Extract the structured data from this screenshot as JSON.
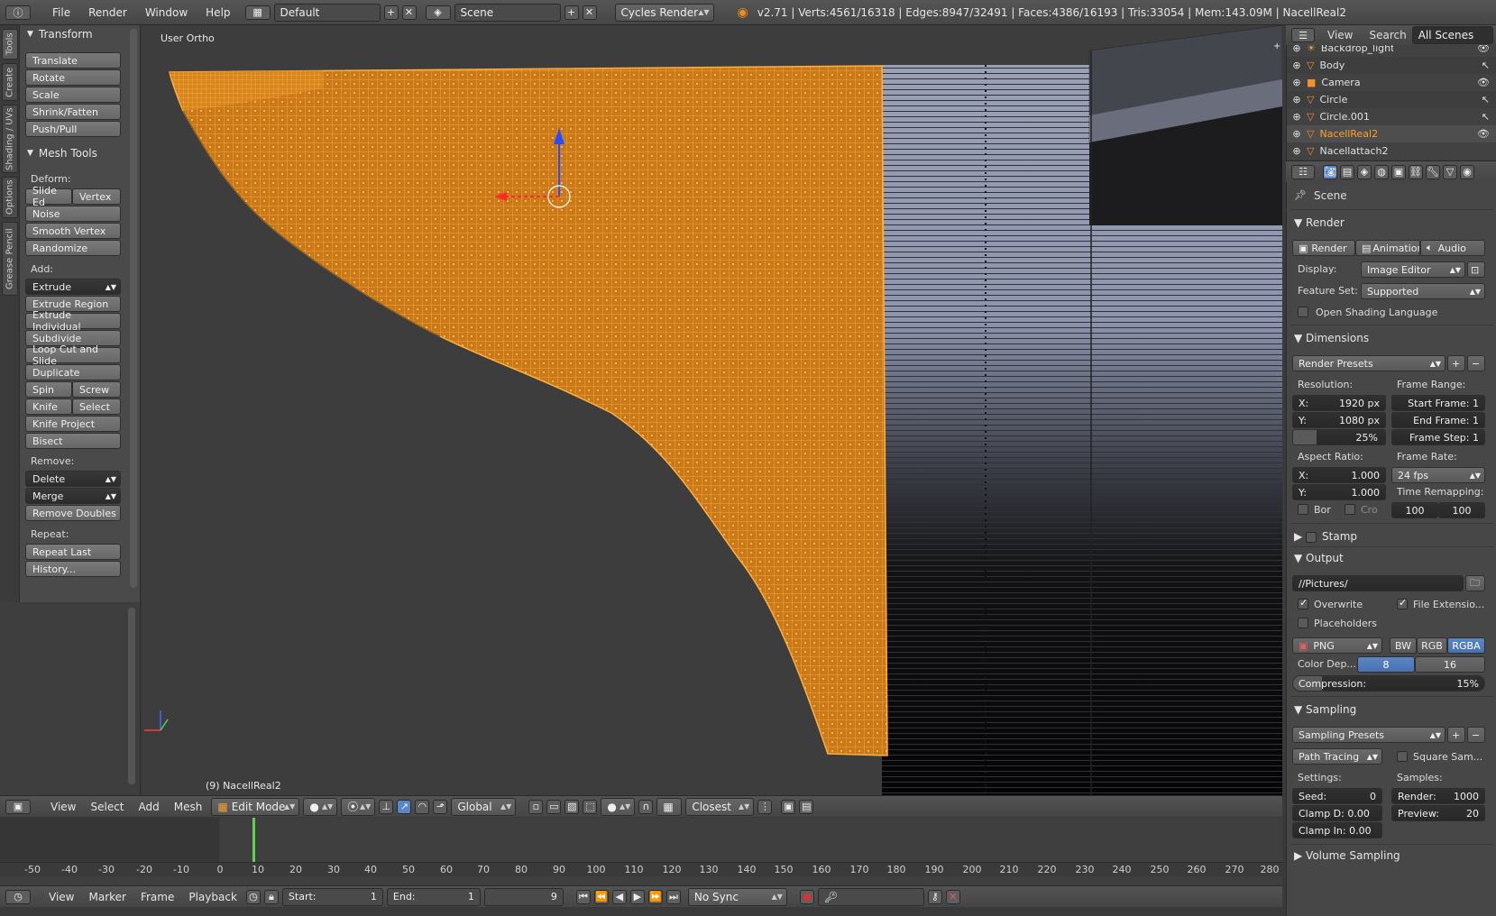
{
  "topbar": {
    "menus": [
      "File",
      "Render",
      "Window",
      "Help"
    ],
    "layout": "Default",
    "scene": "Scene",
    "engine": "Cycles Render",
    "stats": "v2.71 | Verts:4561/16318 | Edges:8947/32491 | Faces:4386/16193 | Tris:33054 | Mem:143.09M | NacellReal2"
  },
  "tool_tabs": [
    "Tools",
    "Create",
    "Shading / UVs",
    "Options",
    "Grease Pencil"
  ],
  "transform": {
    "title": "Transform",
    "buttons": [
      "Translate",
      "Rotate",
      "Scale",
      "Shrink/Fatten",
      "Push/Pull"
    ]
  },
  "mesh_tools": {
    "title": "Mesh Tools",
    "deform_label": "Deform:",
    "slide_edge": "Slide Ed",
    "vertex": "Vertex",
    "noise": "Noise",
    "smooth_vertex": "Smooth Vertex",
    "randomize": "Randomize",
    "add_label": "Add:",
    "extrude": "Extrude",
    "extrude_region": "Extrude Region",
    "extrude_individual": "Extrude Individual",
    "subdivide": "Subdivide",
    "loop_cut": "Loop Cut and Slide",
    "duplicate": "Duplicate",
    "spin": "Spin",
    "screw": "Screw",
    "knife": "Knife",
    "select": "Select",
    "knife_project": "Knife Project",
    "bisect": "Bisect",
    "remove_label": "Remove:",
    "delete": "Delete",
    "merge": "Merge",
    "remove_doubles": "Remove Doubles",
    "repeat_label": "Repeat:",
    "repeat_last": "Repeat Last",
    "history": "History..."
  },
  "viewport": {
    "view_name": "User Ortho",
    "object_label": "(9) NacellReal2",
    "selection_color": "#f39a1e"
  },
  "view3d_header": {
    "menus": [
      "View",
      "Select",
      "Add",
      "Mesh"
    ],
    "mode": "Edit Mode",
    "orientation": "Global",
    "snap": "Closest"
  },
  "timeline": {
    "ruler": [
      "-50",
      "-40",
      "-30",
      "-20",
      "-10",
      "0",
      "10",
      "20",
      "30",
      "40",
      "50",
      "60",
      "70",
      "80",
      "90",
      "100",
      "110",
      "120",
      "130",
      "140",
      "150",
      "160",
      "170",
      "180",
      "190",
      "200",
      "210",
      "220",
      "230",
      "240",
      "250",
      "260",
      "270",
      "280"
    ],
    "menus": [
      "View",
      "Marker",
      "Frame",
      "Playback"
    ],
    "start_label": "Start:",
    "start": "1",
    "end_label": "End:",
    "end": "1",
    "current": "9",
    "sync": "No Sync"
  },
  "outliner": {
    "menus": [
      "View",
      "Search"
    ],
    "filter": "All Scenes",
    "items": [
      "Backdrop_light",
      "Body",
      "Camera",
      "Circle",
      "Circle.001",
      "NacellReal2",
      "Nacellattach2"
    ]
  },
  "properties": {
    "scene": "Scene",
    "render": {
      "title": "Render",
      "render_btn": "Render",
      "animation_btn": "Animation",
      "audio_btn": "Audio",
      "display_label": "Display:",
      "display": "Image Editor",
      "feature_label": "Feature Set:",
      "feature": "Supported",
      "osl": "Open Shading Language"
    },
    "dimensions": {
      "title": "Dimensions",
      "presets": "Render Presets",
      "resolution_label": "Resolution:",
      "res_x": "X:",
      "res_x_val": "1920 px",
      "res_y": "Y:",
      "res_y_val": "1080 px",
      "res_pct": "25%",
      "res_pct_fill": 0.25,
      "frame_range_label": "Frame Range:",
      "start_frame": "Start Frame: 1",
      "end_frame": "End Frame:   1",
      "frame_step": "Frame Step: 1",
      "aspect_label": "Aspect Ratio:",
      "asp_x": "X:",
      "asp_x_val": "1.000",
      "asp_y": "Y:",
      "asp_y_val": "1.000",
      "frame_rate_label": "Frame Rate:",
      "frame_rate": "24 fps",
      "time_remap_label": "Time Remapping:",
      "remap_old": "100",
      "remap_new": "100",
      "border": "Bor",
      "crop": "Cro"
    },
    "stamp": "Stamp",
    "output": {
      "title": "Output",
      "path": "//Pictures/",
      "overwrite": "Overwrite",
      "file_ext": "File Extensio...",
      "placeholders": "Placeholders",
      "format": "PNG",
      "bw": "BW",
      "rgb": "RGB",
      "rgba": "RGBA",
      "color_depth_label": "Color Dep...",
      "depth8": "8",
      "depth16": "16",
      "compression": "Compression:",
      "compression_val": "15%",
      "compression_fill": 0.15
    },
    "sampling": {
      "title": "Sampling",
      "presets": "Sampling Presets",
      "integrator": "Path Tracing",
      "square": "Square Sam...",
      "settings_label": "Settings:",
      "samples_label": "Samples:",
      "seed": "Seed:",
      "seed_val": "0",
      "render_samples": "Render:",
      "render_samples_val": "1000",
      "clamp_d": "Clamp D: 0.00",
      "preview_samples": "Preview:",
      "preview_samples_val": "20",
      "clamp_i": "Clamp In: 0.00"
    },
    "volume_sampling": "Volume Sampling"
  }
}
